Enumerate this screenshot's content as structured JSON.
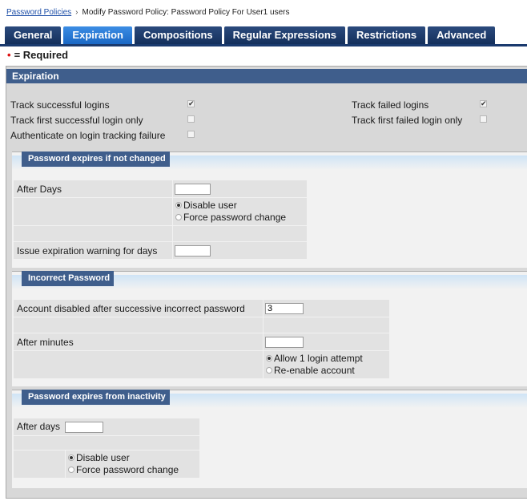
{
  "breadcrumb": {
    "link": "Password Policies",
    "separator": "›",
    "current": "Modify Password Policy: Password Policy For User1 users"
  },
  "tabs": [
    {
      "label": "General",
      "active": false
    },
    {
      "label": "Expiration",
      "active": true
    },
    {
      "label": "Compositions",
      "active": false
    },
    {
      "label": "Regular Expressions",
      "active": false
    },
    {
      "label": "Restrictions",
      "active": false
    },
    {
      "label": "Advanced",
      "active": false
    }
  ],
  "required_note": {
    "marker": "•",
    "text": "= Required"
  },
  "expiration": {
    "header": "Expiration",
    "track_successful": {
      "label": "Track successful logins",
      "checked": true
    },
    "track_first_successful": {
      "label": "Track first successful login only",
      "checked": false
    },
    "authenticate_on_failure": {
      "label": "Authenticate on login tracking failure",
      "checked": false
    },
    "track_failed": {
      "label": "Track failed logins",
      "checked": true
    },
    "track_first_failed": {
      "label": "Track first failed login only",
      "checked": false
    }
  },
  "expires_not_changed": {
    "title": "Password expires if not changed",
    "after_days_label": "After Days",
    "after_days_value": "",
    "disable_user": "Disable user",
    "force_change": "Force password change",
    "selected": "disable",
    "warning_label": "Issue expiration warning for days",
    "warning_value": ""
  },
  "incorrect_password": {
    "title": "Incorrect Password",
    "disabled_after_label": "Account disabled after successive incorrect password",
    "disabled_after_value": "3",
    "after_minutes_label": "After minutes",
    "after_minutes_value": "",
    "allow_one": "Allow 1 login attempt",
    "reenable": "Re-enable account",
    "selected": "allow"
  },
  "inactivity": {
    "title": "Password expires from inactivity",
    "after_days_label": "After days",
    "after_days_value": "",
    "disable_user": "Disable user",
    "force_change": "Force password change",
    "selected": "disable"
  },
  "check_glyph": "✔"
}
